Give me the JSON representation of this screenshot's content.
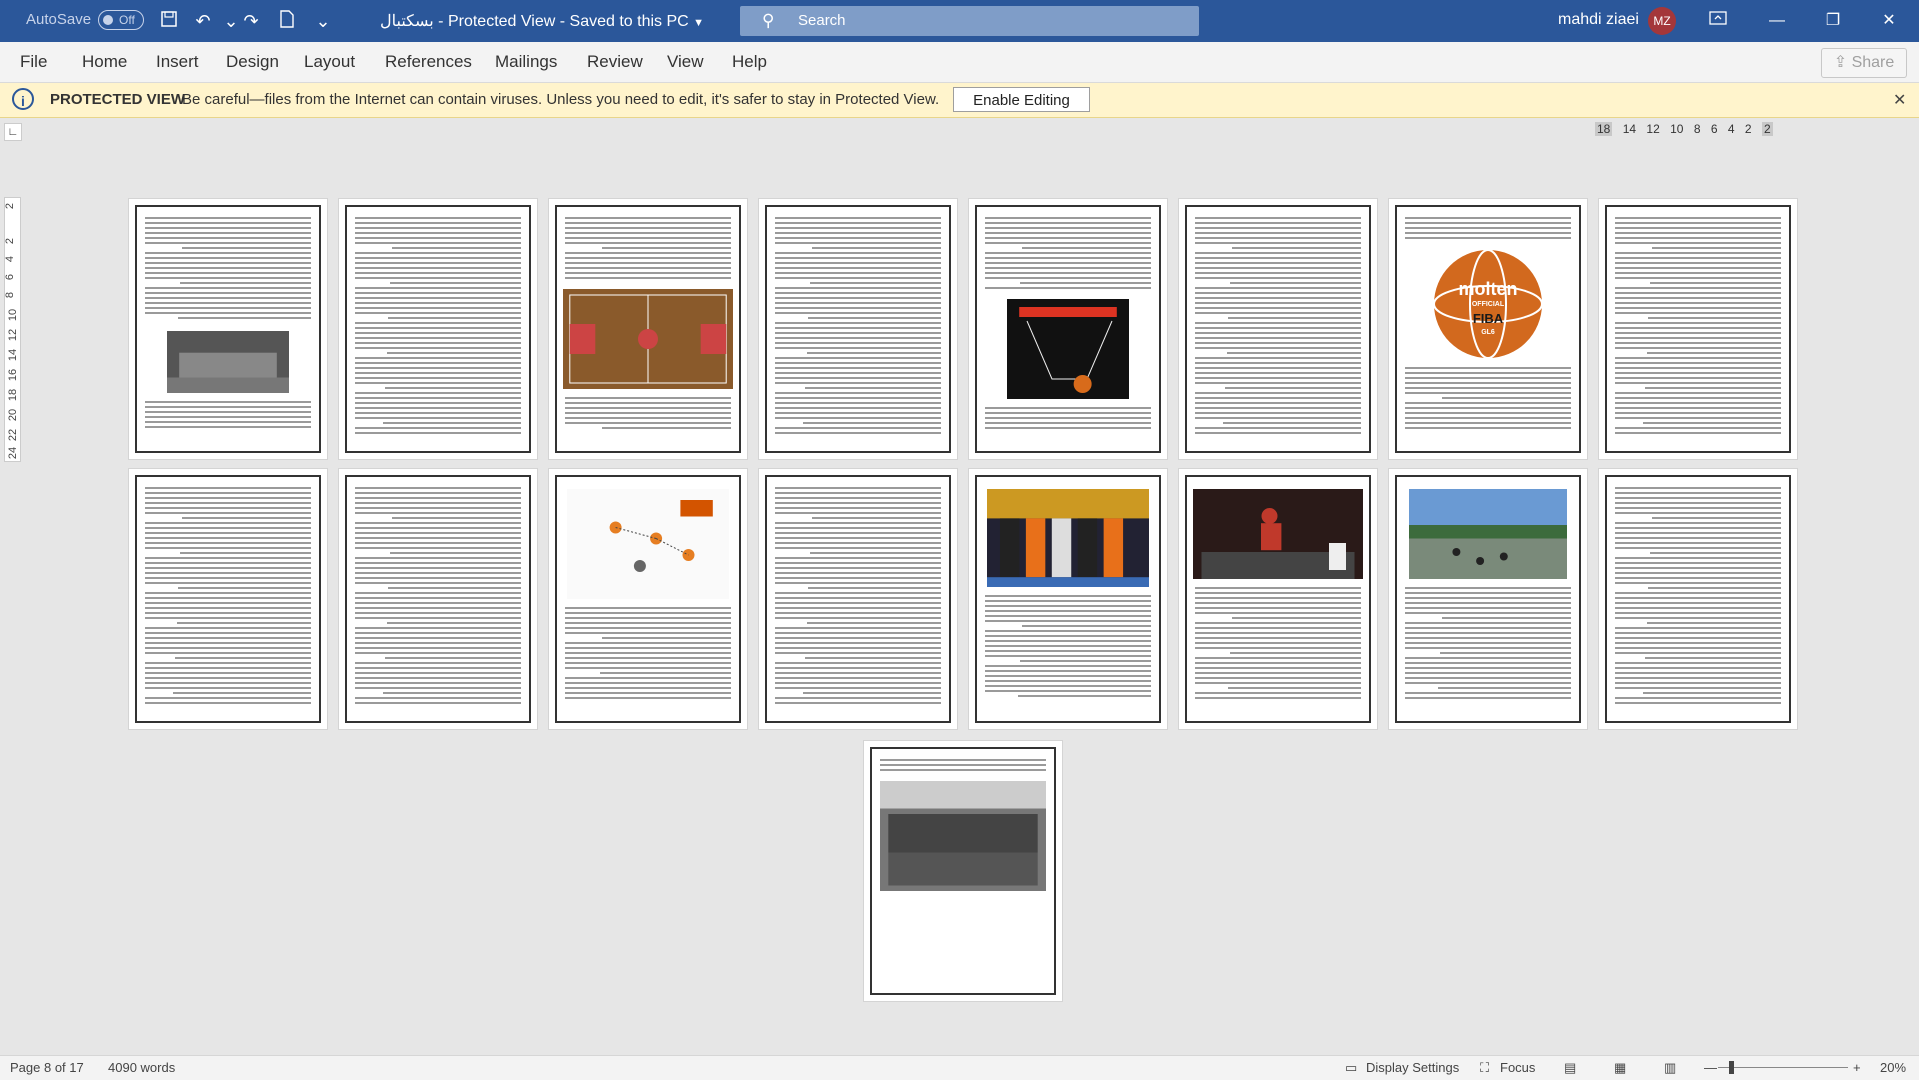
{
  "titlebar": {
    "autosave_label": "AutoSave",
    "autosave_state": "Off",
    "doc_name": "بسکتبال",
    "sep1": "-",
    "mode": "Protected View",
    "sep2": "-",
    "save_state": "Saved to this PC",
    "search_label": "Search",
    "user_name": "mahdi ziaei",
    "user_initials": "MZ"
  },
  "menu": {
    "items": [
      "File",
      "Home",
      "Insert",
      "Design",
      "Layout",
      "References",
      "Mailings",
      "Review",
      "View",
      "Help"
    ],
    "share_label": "Share"
  },
  "protected_view": {
    "title": "PROTECTED VIEW",
    "message": "Be careful—files from the Internet can contain viruses. Unless you need to edit, it's safer to stay in Protected View.",
    "enable_button": "Enable Editing"
  },
  "ruler": {
    "h_ticks": [
      "18",
      "14",
      "12",
      "10",
      "8",
      "6",
      "4",
      "2",
      "2"
    ],
    "v_ticks": [
      "2",
      "2",
      "4",
      "6",
      "8",
      "10",
      "12",
      "14",
      "16",
      "18",
      "20",
      "22",
      "24"
    ]
  },
  "pages": [
    {
      "id": 1,
      "photo": "team-photo"
    },
    {
      "id": 2,
      "photo": "none"
    },
    {
      "id": 3,
      "photo": "court"
    },
    {
      "id": 4,
      "photo": "none"
    },
    {
      "id": 5,
      "photo": "hoop"
    },
    {
      "id": 6,
      "photo": "none"
    },
    {
      "id": 7,
      "photo": "molten-ball"
    },
    {
      "id": 8,
      "photo": "none"
    },
    {
      "id": 9,
      "photo": "none"
    },
    {
      "id": 10,
      "photo": "none"
    },
    {
      "id": 11,
      "photo": "diagram"
    },
    {
      "id": 12,
      "photo": "none"
    },
    {
      "id": 13,
      "photo": "referees"
    },
    {
      "id": 14,
      "photo": "dunk"
    },
    {
      "id": 15,
      "photo": "street-court"
    },
    {
      "id": 16,
      "photo": "none"
    },
    {
      "id": 17,
      "photo": "old-team-photo"
    }
  ],
  "ball_text": {
    "brand": "molten",
    "official": "OFFICIAL",
    "fiba": "FIBA",
    "model": "GL6"
  },
  "status": {
    "page": "Page 8 of 17",
    "words": "4090 words",
    "display_settings": "Display Settings",
    "focus": "Focus",
    "zoom": "20%"
  }
}
